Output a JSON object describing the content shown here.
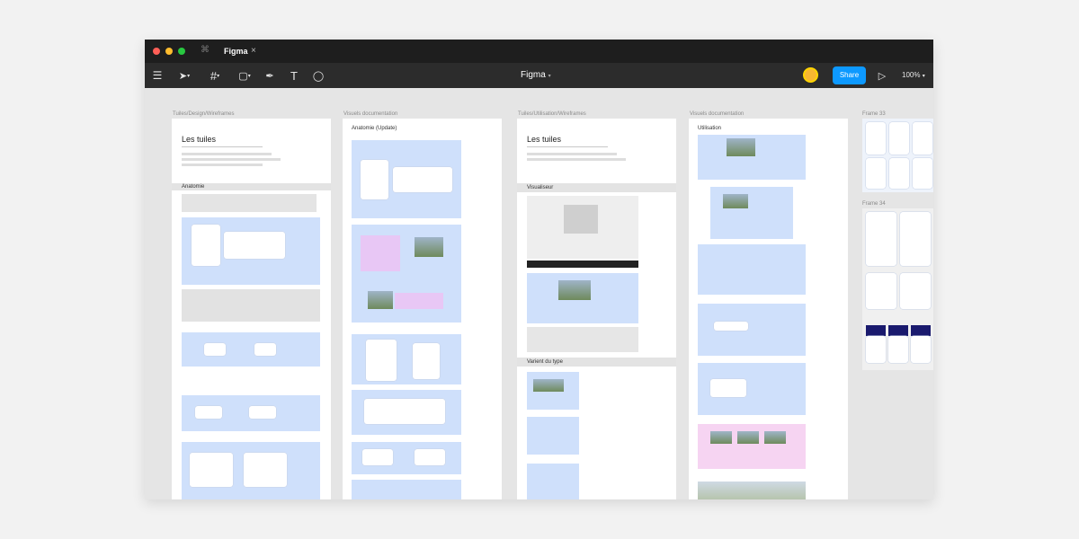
{
  "tab": {
    "title": "Figma",
    "close": "×"
  },
  "toolbar": {
    "title": "Figma",
    "share_label": "Share",
    "zoom": "100%"
  },
  "frames": {
    "f1": {
      "label": "Tuiles/Design/Wireframes",
      "heading": "Les tuiles",
      "section": "Anatomie"
    },
    "f2": {
      "label": "Visuels documentation",
      "heading": "Anatomie (Update)"
    },
    "f3": {
      "label": "Tuiles/Utilisation/Wireframes",
      "heading": "Les tuiles",
      "section1": "Visualiseur",
      "section2": "Varient du type"
    },
    "f4": {
      "label": "Visuels documentation",
      "heading": "Utilisation"
    },
    "f5": {
      "label": "Frame 33"
    },
    "f6": {
      "label": "Frame 34"
    }
  },
  "colors": {
    "accent": "#0d99ff",
    "canvas": "#e5e5e5",
    "toolbar": "#2c2c2c"
  },
  "icons": [
    "menu-icon",
    "move-tool-icon",
    "frame-tool-icon",
    "shape-tool-icon",
    "pen-tool-icon",
    "text-tool-icon",
    "comment-tool-icon",
    "play-icon"
  ]
}
